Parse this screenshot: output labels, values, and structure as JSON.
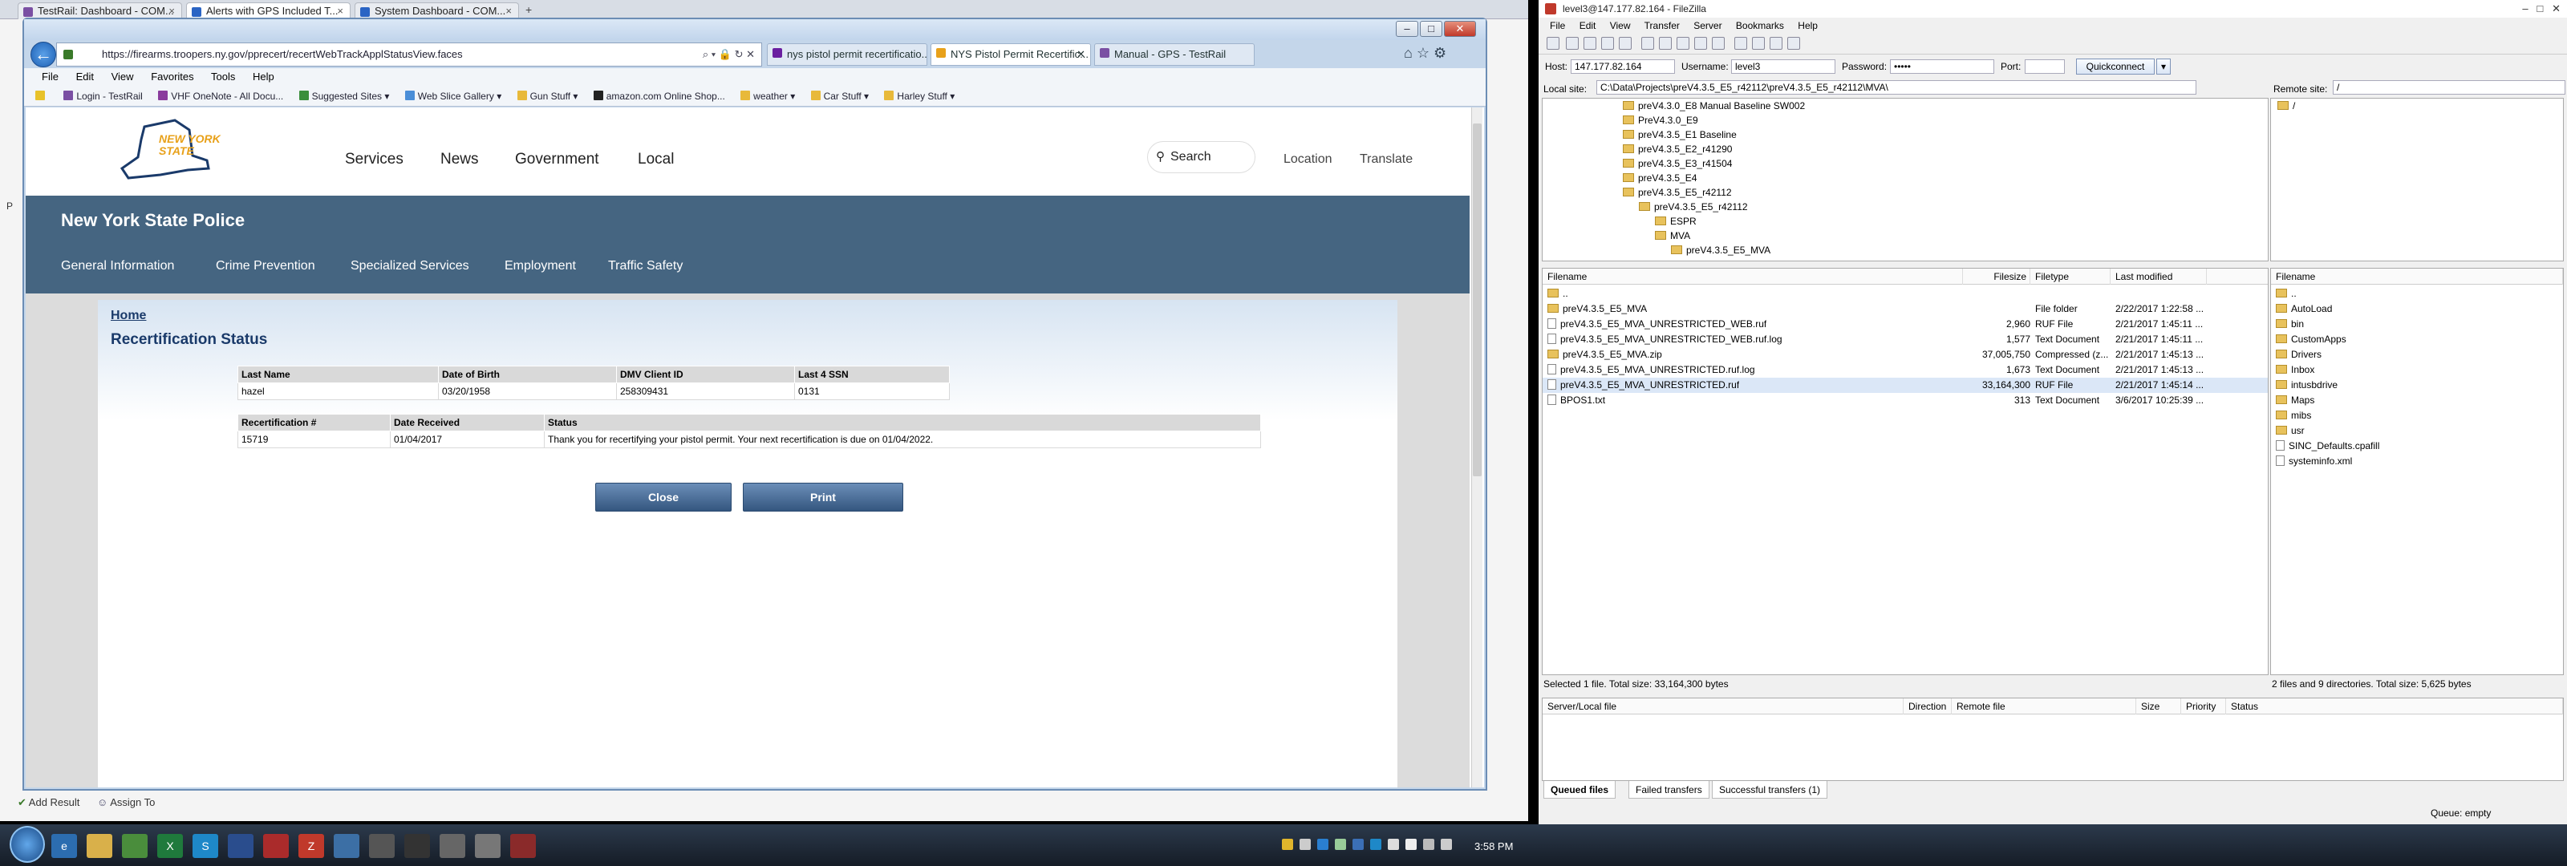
{
  "background_browser": {
    "tabs": [
      {
        "label": "TestRail: Dashboard - COM..."
      },
      {
        "label": "Alerts with GPS Included T..."
      },
      {
        "label": "System Dashboard - COM..."
      }
    ]
  },
  "ie": {
    "address": "https://firearms.troopers.ny.gov/pprecert/recertWebTrackApplStatusView.faces",
    "tabs": [
      {
        "label": "nys pistol permit recertificatio..."
      },
      {
        "label": "NYS Pistol Permit Recertific..."
      },
      {
        "label": "Manual - GPS - TestRail"
      }
    ],
    "menu": [
      "File",
      "Edit",
      "View",
      "Favorites",
      "Tools",
      "Help"
    ],
    "favorites": [
      "Favorites",
      "Login - TestRail",
      "VHF OneNote - All Docu...",
      "Suggested Sites",
      "Web Slice Gallery",
      "Gun Stuff",
      "amazon.com Online Shop...",
      "weather",
      "Car Stuff",
      "Harley Stuff"
    ]
  },
  "page": {
    "logo_text": "NEW YORK STATE",
    "nav": [
      "Services",
      "News",
      "Government",
      "Local"
    ],
    "search_label": "Search",
    "location_label": "Location",
    "translate_label": "Translate",
    "agency": "New York State Police",
    "subnav": [
      "General Information",
      "Crime Prevention",
      "Specialized Services",
      "Employment",
      "Traffic Safety"
    ],
    "home": "Home",
    "title": "Recertification Status",
    "person_table": {
      "headers": [
        "Last Name",
        "Date of Birth",
        "DMV Client ID",
        "Last 4 SSN"
      ],
      "row": [
        "hazel",
        "03/20/1958",
        "258309431",
        "0131"
      ]
    },
    "recert_table": {
      "headers": [
        "Recertification #",
        "Date Received",
        "Status"
      ],
      "row": [
        "15719",
        "01/04/2017",
        "Thank you for recertifying your pistol permit. Your next recertification is due on 01/04/2022."
      ]
    },
    "close_label": "Close",
    "print_label": "Print"
  },
  "testrail_footer": {
    "add_result": "Add Result",
    "assign_to": "Assign To"
  },
  "filezilla": {
    "title": "level3@147.177.82.164 - FileZilla",
    "menu": [
      "File",
      "Edit",
      "View",
      "Transfer",
      "Server",
      "Bookmarks",
      "Help"
    ],
    "host_label": "Host:",
    "host": "147.177.82.164",
    "user_label": "Username:",
    "user": "level3",
    "pass_label": "Password:",
    "pass": "•••••",
    "port_label": "Port:",
    "port": "",
    "quickconnect": "Quickconnect",
    "local_site_label": "Local site:",
    "local_site": "C:\\Data\\Projects\\preV4.3.5_E5_r42112\\preV4.3.5_E5_r42112\\MVA\\",
    "remote_site_label": "Remote site:",
    "remote_site": "/",
    "tree": [
      "preV4.3.0_E8 Manual Baseline SW002",
      "PreV4.3.0_E9",
      "preV4.3.5_E1 Baseline",
      "preV4.3.5_E2_r41290",
      "preV4.3.5_E3_r41504",
      "preV4.3.5_E4",
      "preV4.3.5_E5_r42112",
      "preV4.3.5_E5_r42112",
      "ESPR",
      "MVA",
      "preV4.3.5_E5_MVA"
    ],
    "local_headers": [
      "Filename",
      "Filesize",
      "Filetype",
      "Last modified"
    ],
    "local_files": [
      {
        "name": "..",
        "size": "",
        "type": "",
        "modified": ""
      },
      {
        "name": "preV4.3.5_E5_MVA",
        "size": "",
        "type": "File folder",
        "modified": "2/22/2017 1:22:58 ..."
      },
      {
        "name": "preV4.3.5_E5_MVA_UNRESTRICTED_WEB.ruf",
        "size": "2,960",
        "type": "RUF File",
        "modified": "2/21/2017 1:45:11 ..."
      },
      {
        "name": "preV4.3.5_E5_MVA_UNRESTRICTED_WEB.ruf.log",
        "size": "1,577",
        "type": "Text Document",
        "modified": "2/21/2017 1:45:11 ..."
      },
      {
        "name": "preV4.3.5_E5_MVA.zip",
        "size": "37,005,750",
        "type": "Compressed (z...",
        "modified": "2/21/2017 1:45:13 ..."
      },
      {
        "name": "preV4.3.5_E5_MVA_UNRESTRICTED.ruf.log",
        "size": "1,673",
        "type": "Text Document",
        "modified": "2/21/2017 1:45:13 ..."
      },
      {
        "name": "preV4.3.5_E5_MVA_UNRESTRICTED.ruf",
        "size": "33,164,300",
        "type": "RUF File",
        "modified": "2/21/2017 1:45:14 ..."
      },
      {
        "name": "BPOS1.txt",
        "size": "313",
        "type": "Text Document",
        "modified": "3/6/2017 10:25:39 ..."
      }
    ],
    "remote_header": "Filename",
    "remote_files": [
      "..",
      "AutoLoad",
      "bin",
      "CustomApps",
      "Drivers",
      "Inbox",
      "intusbdrive",
      "Maps",
      "mibs",
      "usr",
      "SINC_Defaults.cpafill",
      "systeminfo.xml"
    ],
    "local_status": "Selected 1 file. Total size: 33,164,300 bytes",
    "remote_status": "2 files and 9 directories. Total size: 5,625 bytes",
    "queue_headers": [
      "Server/Local file",
      "Direction",
      "Remote file",
      "Size",
      "Priority",
      "Status"
    ],
    "queue_tabs": [
      "Queued files",
      "Failed transfers",
      "Successful transfers (1)"
    ],
    "queue_status": "Queue: empty"
  },
  "taskbar": {
    "clock": "3:58 PM"
  }
}
